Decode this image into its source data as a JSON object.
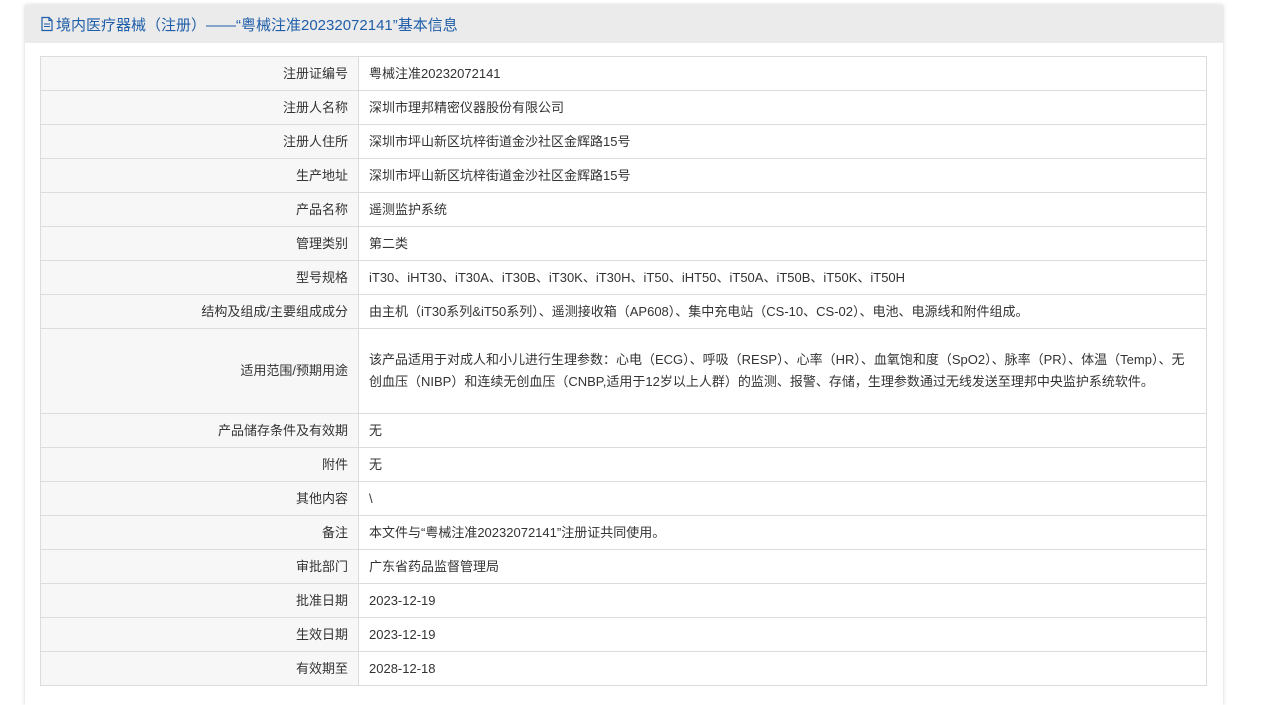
{
  "header": {
    "title": "境内医疗器械（注册）——“粤械注准20232072141”基本信息",
    "icon": "document-icon"
  },
  "rows": [
    {
      "label": "注册证编号",
      "value": "粤械注准20232072141"
    },
    {
      "label": "注册人名称",
      "value": "深圳市理邦精密仪器股份有限公司"
    },
    {
      "label": "注册人住所",
      "value": "深圳市坪山新区坑梓街道金沙社区金辉路15号"
    },
    {
      "label": "生产地址",
      "value": "深圳市坪山新区坑梓街道金沙社区金辉路15号"
    },
    {
      "label": "产品名称",
      "value": "遥测监护系统"
    },
    {
      "label": "管理类别",
      "value": "第二类"
    },
    {
      "label": "型号规格",
      "value": "iT30、iHT30、iT30A、iT30B、iT30K、iT30H、iT50、iHT50、iT50A、iT50B、iT50K、iT50H"
    },
    {
      "label": "结构及组成/主要组成成分",
      "value": "由主机（iT30系列&iT50系列）、遥测接收箱（AP608）、集中充电站（CS-10、CS-02）、电池、电源线和附件组成。"
    },
    {
      "label": "适用范围/预期用途",
      "value": "该产品适用于对成人和小儿进行生理参数：心电（ECG）、呼吸（RESP）、心率（HR）、血氧饱和度（SpO2）、脉率（PR）、体温（Temp）、无创血压（NIBP）和连续无创血压（CNBP,适用于12岁以上人群）的监测、报警、存储，生理参数通过无线发送至理邦中央监护系统软件。"
    },
    {
      "label": "产品储存条件及有效期",
      "value": "无"
    },
    {
      "label": "附件",
      "value": "无"
    },
    {
      "label": "其他内容",
      "value": "\\"
    },
    {
      "label": "备注",
      "value": "本文件与“粤械注准20232072141”注册证共同使用。"
    },
    {
      "label": "审批部门",
      "value": "广东省药品监督管理局"
    },
    {
      "label": "批准日期",
      "value": "2023-12-19"
    },
    {
      "label": "生效日期",
      "value": "2023-12-19"
    },
    {
      "label": "有效期至",
      "value": "2028-12-18"
    }
  ]
}
